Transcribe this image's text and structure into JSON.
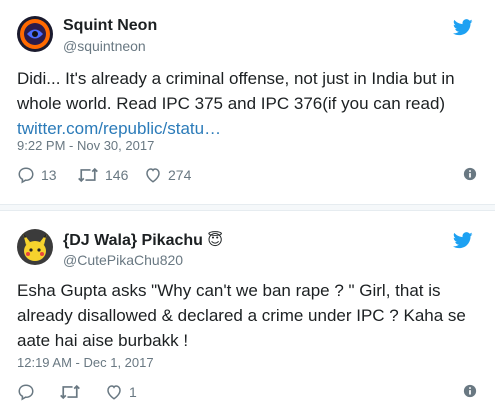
{
  "tweets": [
    {
      "display_name": "Squint Neon",
      "handle": "@squintneon",
      "text": "Didi... It's already a criminal offense, not just in India but in whole world. Read IPC 375 and IPC 376(if you can read)",
      "link": "twitter.com/republic/statu…",
      "timestamp": "9:22 PM - Nov 30, 2017",
      "replies": "13",
      "retweets": "146",
      "likes": "274",
      "avatar_icon": "neon-eye-avatar-icon"
    },
    {
      "display_name": "{DJ Wala} Pikachu",
      "emoji": "😇",
      "handle": "@CutePikaChu820",
      "text": "Esha Gupta asks \"Why can't we ban rape ? \" Girl, that is already disallowed & declared a crime under IPC ? Kaha se aate hai aise burbakk !",
      "timestamp": "12:19 AM - Dec 1, 2017",
      "replies": "",
      "retweets": "",
      "likes": "1",
      "avatar_icon": "pikachu-avatar-icon"
    }
  ],
  "colors": {
    "twitter_blue": "#1da1f2",
    "link": "#2b7bb9",
    "meta_gray": "#697882",
    "text": "#1c2022",
    "divider": "#e6ecf0"
  }
}
